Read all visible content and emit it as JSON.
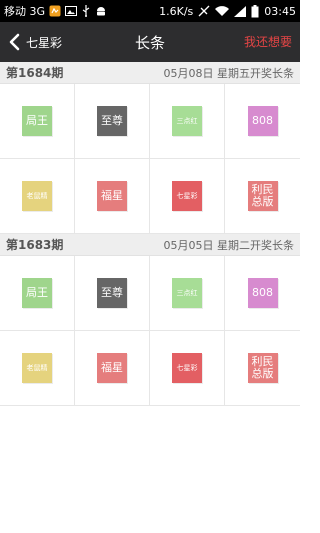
{
  "status_bar": {
    "carrier": "移动 3G",
    "speed": "1.6K/s",
    "time": "03:45"
  },
  "nav": {
    "back_label": "七星彩",
    "title": "长条",
    "action_label": "我还想要"
  },
  "colors": {
    "nav_bg": "#2d2d2f",
    "action": "#e44545",
    "green": "#9fd58c",
    "dark": "#666666",
    "yellow": "#e5d37e",
    "coral": "#e57d7d",
    "red": "#e35f63",
    "purple": "#d78bcf"
  },
  "periods": [
    {
      "issue": "第1684期",
      "info": "05月08日  星期五开奖长条",
      "tiles": [
        {
          "label": "局王",
          "color": "#9fd58c"
        },
        {
          "label": "至尊",
          "color": "#666666"
        },
        {
          "label": "三点红",
          "color": "#a7dd96"
        },
        {
          "label": "808",
          "color": "#d78bcf"
        },
        {
          "label": "老鼠精",
          "color": "#e5d37e"
        },
        {
          "label": "福星",
          "color": "#e57d7d"
        },
        {
          "label": "七星彩",
          "color": "#e35f63"
        },
        {
          "label": "利民总版",
          "color": "#e57d7d"
        }
      ]
    },
    {
      "issue": "第1683期",
      "info": "05月05日  星期二开奖长条",
      "tiles": [
        {
          "label": "局王",
          "color": "#9fd58c"
        },
        {
          "label": "至尊",
          "color": "#666666"
        },
        {
          "label": "三点红",
          "color": "#a7dd96"
        },
        {
          "label": "808",
          "color": "#d78bcf"
        },
        {
          "label": "老鼠精",
          "color": "#e5d37e"
        },
        {
          "label": "福星",
          "color": "#e57d7d"
        },
        {
          "label": "七星彩",
          "color": "#e35f63"
        },
        {
          "label": "利民总版",
          "color": "#e57d7d"
        }
      ]
    }
  ]
}
